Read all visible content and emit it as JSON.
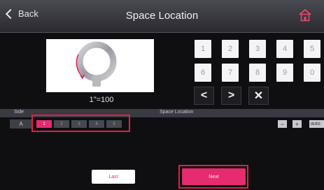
{
  "header": {
    "back_label": "Back",
    "title": "Space Location",
    "home_icon": "home-icon"
  },
  "preview": {
    "scale_label": "1\"=100"
  },
  "keypad": {
    "row1": [
      "1",
      "2",
      "3",
      "4",
      "5"
    ],
    "row2": [
      "6",
      "7",
      "8",
      "9",
      "0"
    ],
    "nav": [
      "<",
      ">",
      "✕"
    ]
  },
  "table": {
    "side_header": "Side",
    "location_header": "Space Location",
    "side_value": "A",
    "cells": [
      "1",
      "2",
      "3",
      "4",
      "5"
    ],
    "active_cell": "1",
    "minus_label": "−",
    "plus_label": "+",
    "auto_label": "auto"
  },
  "footer": {
    "last_label": "Last",
    "next_label": "Next"
  },
  "colors": {
    "accent": "#e62b6e",
    "highlight_box": "#e02046"
  }
}
